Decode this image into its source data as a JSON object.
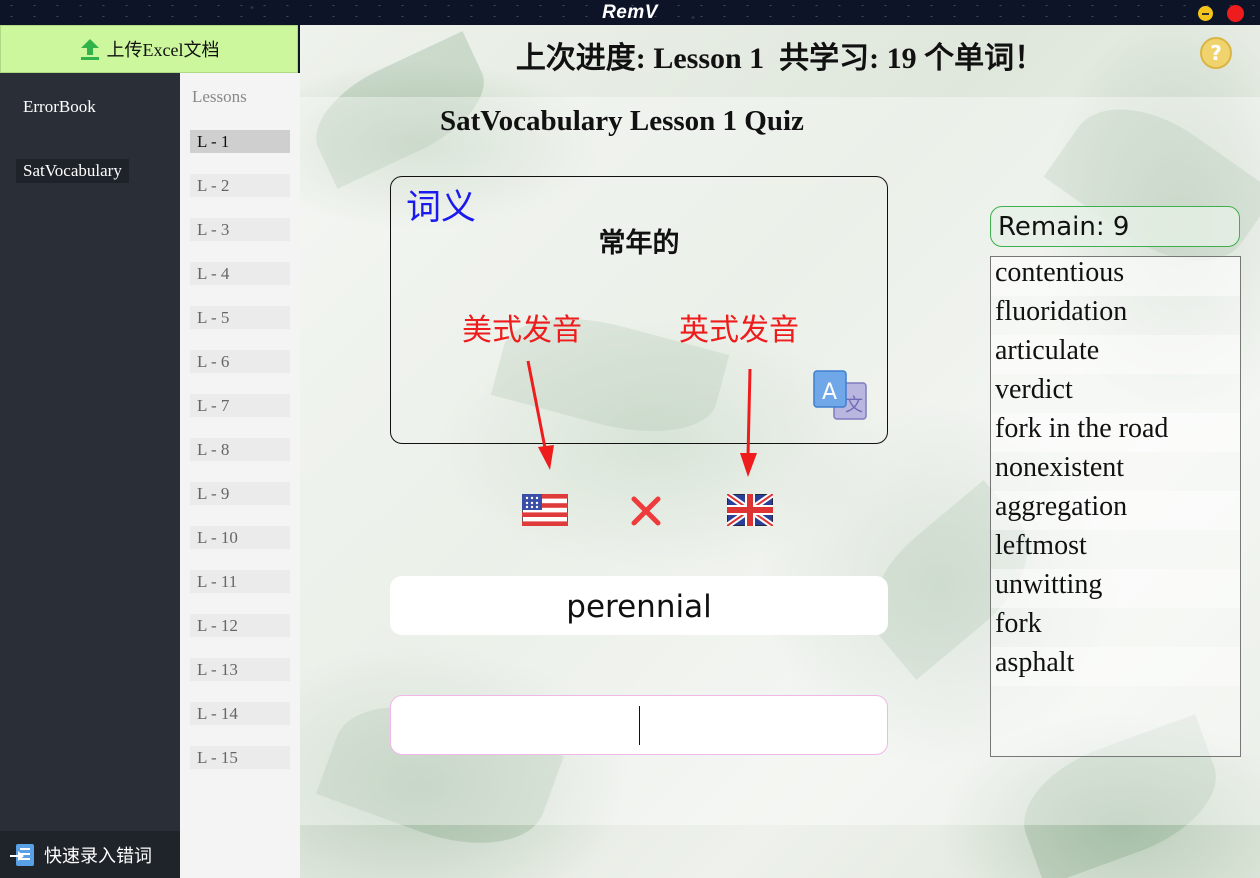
{
  "window": {
    "title": "RemV"
  },
  "sidebar": {
    "upload_label": "上传Excel文档",
    "items": [
      {
        "label": "ErrorBook"
      },
      {
        "label": "SatVocabulary"
      }
    ],
    "quick_entry_label": "快速录入错词"
  },
  "lessons": {
    "header": "Lessons",
    "items": [
      "L - 1",
      "L - 2",
      "L - 3",
      "L - 4",
      "L - 5",
      "L - 6",
      "L - 7",
      "L - 8",
      "L - 9",
      "L - 10",
      "L - 11",
      "L - 12",
      "L - 13",
      "L - 14",
      "L - 15"
    ],
    "selected": "L - 1"
  },
  "header": {
    "progress_prefix": "上次进度: ",
    "progress_lesson": "Lesson 1",
    "progress_mid": "  共学习: ",
    "progress_count": "19",
    "progress_suffix": " 个单词！"
  },
  "quiz": {
    "title": "SatVocabulary Lesson 1 Quiz",
    "meaning_tag": "词义",
    "meaning": "常年的",
    "annotation_us": "美式发音",
    "annotation_uk": "英式发音",
    "word": "perennial",
    "answer_value": ""
  },
  "remain": {
    "label": "Remain: 9"
  },
  "word_list": [
    "contentious",
    "fluoridation",
    "articulate",
    "verdict",
    "fork in the road",
    "nonexistent",
    "aggregation",
    "leftmost",
    "unwitting",
    "fork",
    "asphalt"
  ],
  "colors": {
    "upload_bg": "#ccf79d",
    "sidebar_bg": "#2a2f37",
    "annotation_red": "#ee1c1c",
    "meaning_tag_blue": "#1a1aee",
    "remain_border": "#3fae4c"
  },
  "icons": [
    "upload-icon",
    "quick-entry-icon",
    "help-icon",
    "translate-icon",
    "us-flag-icon",
    "close-icon",
    "uk-flag-icon"
  ]
}
